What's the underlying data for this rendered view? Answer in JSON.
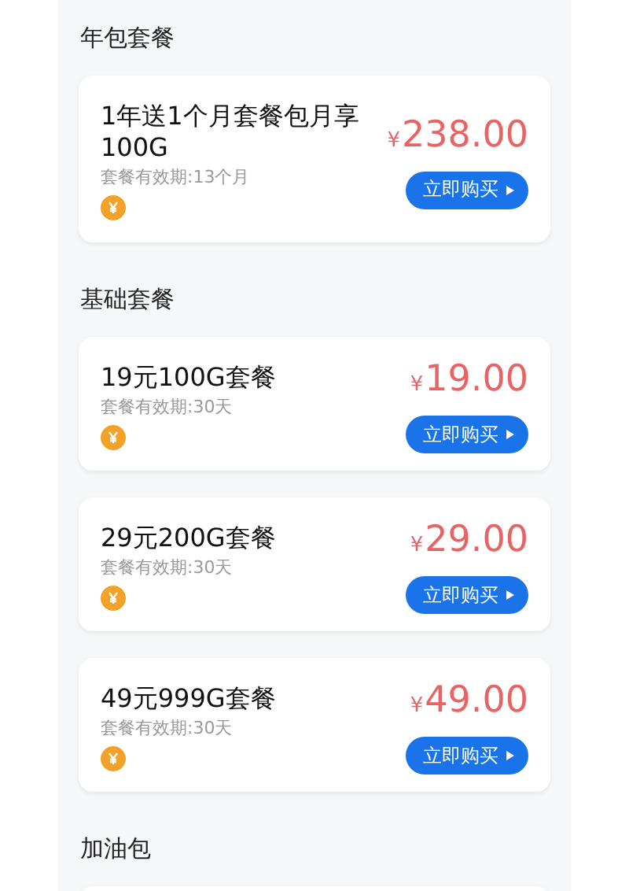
{
  "sections": [
    {
      "title": "年包套餐",
      "plans": [
        {
          "name": "1年送1个月套餐包月享100G",
          "validity": "套餐有效期:13个月",
          "currency": "¥",
          "amount": "238.00",
          "button": "立即购买"
        }
      ]
    },
    {
      "title": "基础套餐",
      "plans": [
        {
          "name": "19元100G套餐",
          "validity": "套餐有效期:30天",
          "currency": "¥",
          "amount": "19.00",
          "button": "立即购买"
        },
        {
          "name": "29元200G套餐",
          "validity": "套餐有效期:30天",
          "currency": "¥",
          "amount": "29.00",
          "button": "立即购买"
        },
        {
          "name": "49元999G套餐",
          "validity": "套餐有效期:30天",
          "currency": "¥",
          "amount": "49.00",
          "button": "立即购买"
        }
      ]
    },
    {
      "title": "加油包"
    }
  ]
}
